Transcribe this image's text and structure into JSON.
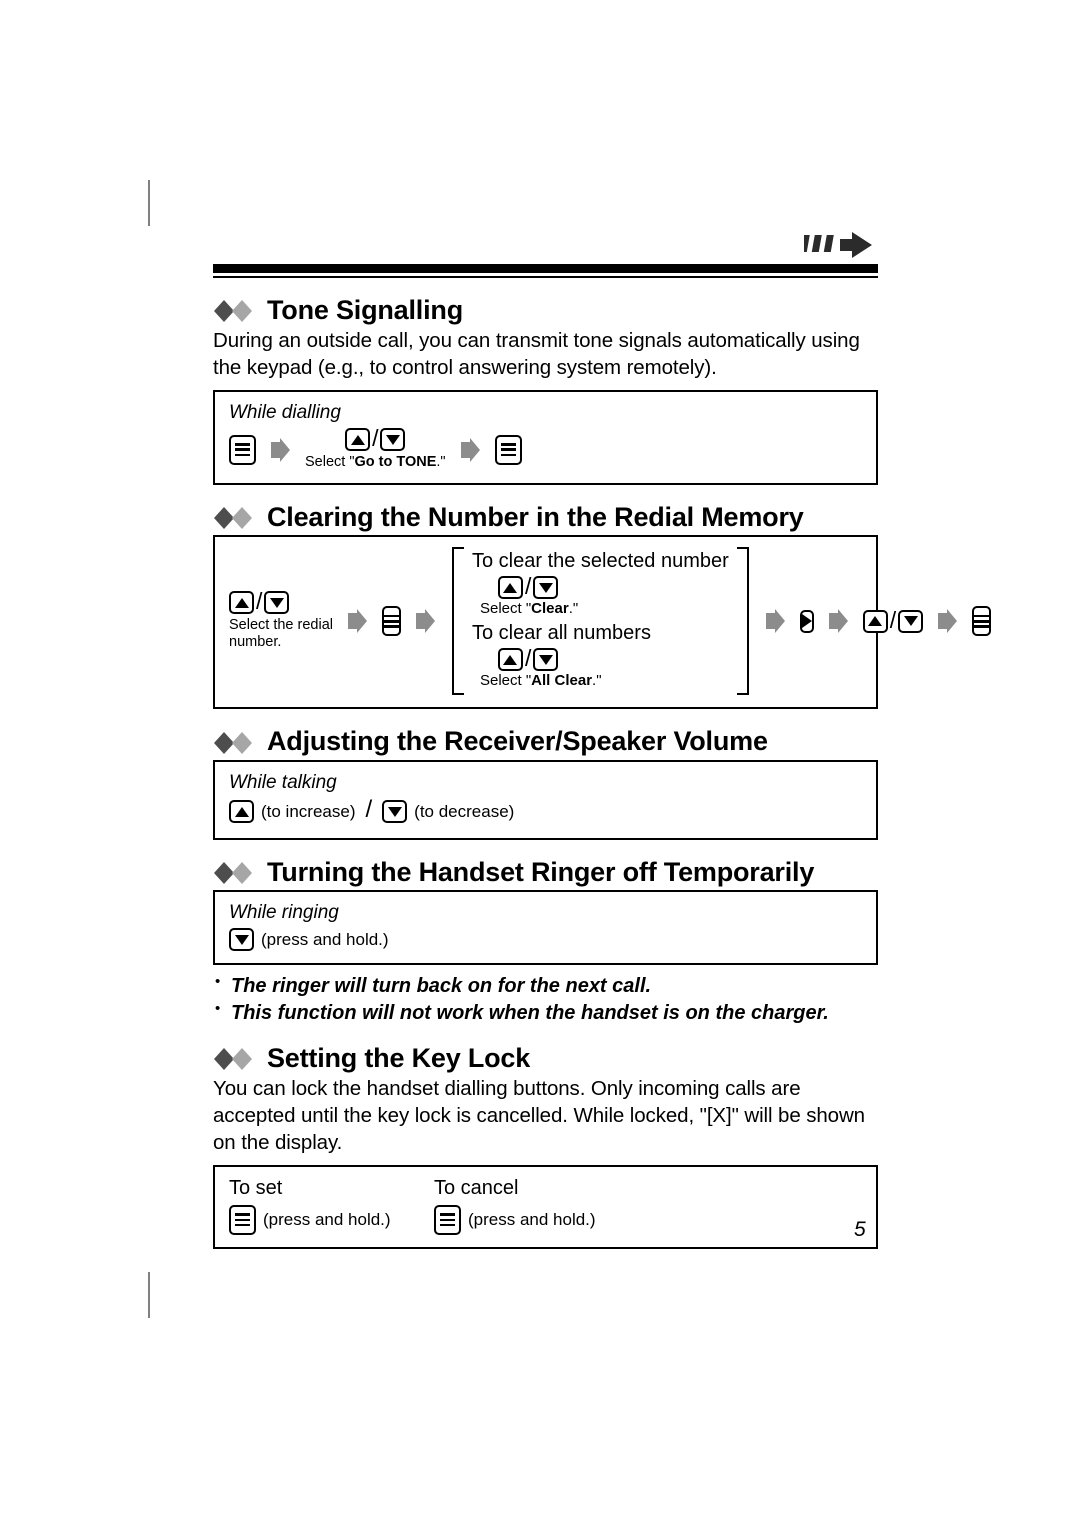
{
  "page": {
    "number": "5",
    "header_icon": "motion-arrow-icon"
  },
  "sections": [
    {
      "id": "tone-signalling",
      "title": "Tone Signalling",
      "body": "During an outside call, you can transmit tone signals automatically using the keypad (e.g., to control answering system remotely).",
      "box": {
        "caption": "While dialling",
        "steps": [
          {
            "icon": "menu-key-icon"
          },
          {
            "icon": "flow-arrow-icon"
          },
          {
            "icon": "up-down-key-icon",
            "label_prefix": "Select \"",
            "label_bold": "Go to TONE",
            "label_suffix": ".\""
          },
          {
            "icon": "flow-arrow-icon"
          },
          {
            "icon": "menu-key-icon"
          }
        ],
        "select_label": "Select \"Go to TONE.\""
      }
    },
    {
      "id": "clearing-redial-memory",
      "title": "Clearing the Number in the Redial Memory",
      "box": {
        "lead": {
          "icon": "up-down-key-icon",
          "caption_line1": "Select the redial",
          "caption_line2": "number."
        },
        "menu_icon": "menu-key-icon",
        "options": [
          {
            "title": "To clear the selected number",
            "icon": "up-down-key-icon",
            "select_prefix": "Select \"",
            "select_bold": "Clear",
            "select_suffix": ".\""
          },
          {
            "title": "To clear all numbers",
            "icon": "up-down-key-icon",
            "select_prefix": "Select \"",
            "select_bold": "All Clear",
            "select_suffix": ".\""
          }
        ],
        "tail": [
          {
            "icon": "right-key-icon"
          },
          {
            "icon": "up-down-key-icon"
          },
          {
            "icon": "menu-key-icon"
          }
        ]
      }
    },
    {
      "id": "adjusting-volume",
      "title": "Adjusting the Receiver/Speaker Volume",
      "box": {
        "caption": "While talking",
        "up_note": "(to increase)",
        "separator": "/",
        "down_note": "(to decrease)"
      }
    },
    {
      "id": "ringer-off",
      "title": "Turning the Handset Ringer off Temporarily",
      "box": {
        "caption": "While ringing",
        "down_note": "(press and hold.)"
      },
      "notes": [
        "The ringer will turn back on for the next call.",
        "This function will not work when the handset is on the charger."
      ]
    },
    {
      "id": "key-lock",
      "title": "Setting the Key Lock",
      "body": "You can lock the handset dialling buttons. Only incoming calls are accepted until the key lock is cancelled. While locked, \"[X]\" will be shown on the display.",
      "box": {
        "set_title": "To set",
        "set_note": "(press and hold.)",
        "cancel_title": "To cancel",
        "cancel_note": "(press and hold.)"
      }
    }
  ],
  "colors": {
    "ink": "#000000",
    "diamond_dark": "#4d4d4d",
    "diamond_light": "#a6a6a6",
    "arrow_gray": "#8c8c8c",
    "crop_mark": "#808080"
  }
}
